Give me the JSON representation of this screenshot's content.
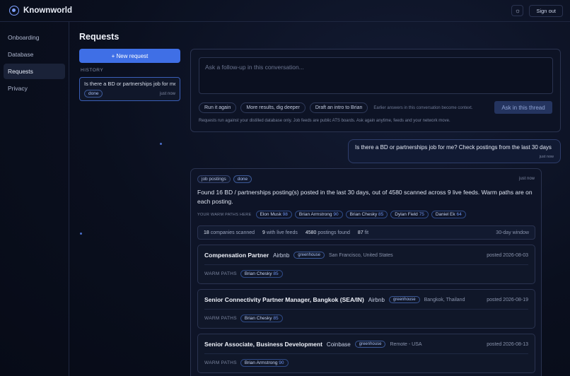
{
  "app": {
    "name": "Knownworld"
  },
  "header": {
    "theme_icon": "sun-icon",
    "signout_label": "Sign out"
  },
  "sidebar": {
    "items": [
      {
        "label": "Onboarding",
        "active": false
      },
      {
        "label": "Database",
        "active": false
      },
      {
        "label": "Requests",
        "active": true
      },
      {
        "label": "Privacy",
        "active": false
      }
    ]
  },
  "page": {
    "title": "Requests"
  },
  "left_panel": {
    "new_request_label": "+ New request",
    "history_label": "HISTORY",
    "history": [
      {
        "question": "Is there a BD or partnerships job for me?...",
        "status": "done",
        "time": "just now"
      }
    ]
  },
  "composer": {
    "placeholder": "Ask a follow-up in this conversation...",
    "suggestions": [
      "Run it again",
      "More results, dig deeper",
      "Draft an intro to Brian"
    ],
    "suggestion_note": "Earlier answers in this conversation become context.",
    "ask_label": "Ask in this thread",
    "footer": "Requests run against your distilled database only. Job feeds are public ATS boards. Ask again anytime, feeds and your network move."
  },
  "user_message": {
    "text": "Is there a BD or partnerships job for me? Check postings from the last 30 days",
    "time": "just now"
  },
  "result": {
    "tags": [
      "job postings",
      "done"
    ],
    "time": "just now",
    "summary": "Found 16 BD / partnerships posting(s) posted in the last 30 days, out of 4580 scanned across 9 live feeds. Warm paths are on each posting.",
    "warm_label": "YOUR WARM PATHS HERE",
    "warm_paths": [
      {
        "name": "Elon Musk",
        "score": "98"
      },
      {
        "name": "Brian Armstrong",
        "score": "90"
      },
      {
        "name": "Brian Chesky",
        "score": "85"
      },
      {
        "name": "Dylan Field",
        "score": "75"
      },
      {
        "name": "Daniel Ek",
        "score": "64"
      }
    ],
    "stats": {
      "companies_count": "18",
      "companies_label": "companies scanned",
      "feeds_count": "9",
      "feeds_label": "with live feeds",
      "postings_count": "4580",
      "postings_label": "postings found",
      "fit_count": "87",
      "fit_label": "fit",
      "window": "30-day window"
    },
    "warm_paths_label": "WARM PATHS",
    "jobs": [
      {
        "title": "Compensation Partner",
        "company": "Airbnb",
        "source": "greenhouse",
        "location": "San Francisco, United States",
        "posted": "posted 2026-08-03",
        "warm_name": "Brian Chesky",
        "warm_score": "85"
      },
      {
        "title": "Senior Connectivity Partner Manager, Bangkok (SEA/IN)",
        "company": "Airbnb",
        "source": "greenhouse",
        "location": "Bangkok, Thailand",
        "posted": "posted 2026-08-19",
        "warm_name": "Brian Chesky",
        "warm_score": "85"
      },
      {
        "title": "Senior Associate, Business Development",
        "company": "Coinbase",
        "source": "greenhouse",
        "location": "Remote - USA",
        "posted": "posted 2026-08-13",
        "warm_name": "Brian Armstrong",
        "warm_score": "90"
      }
    ]
  }
}
